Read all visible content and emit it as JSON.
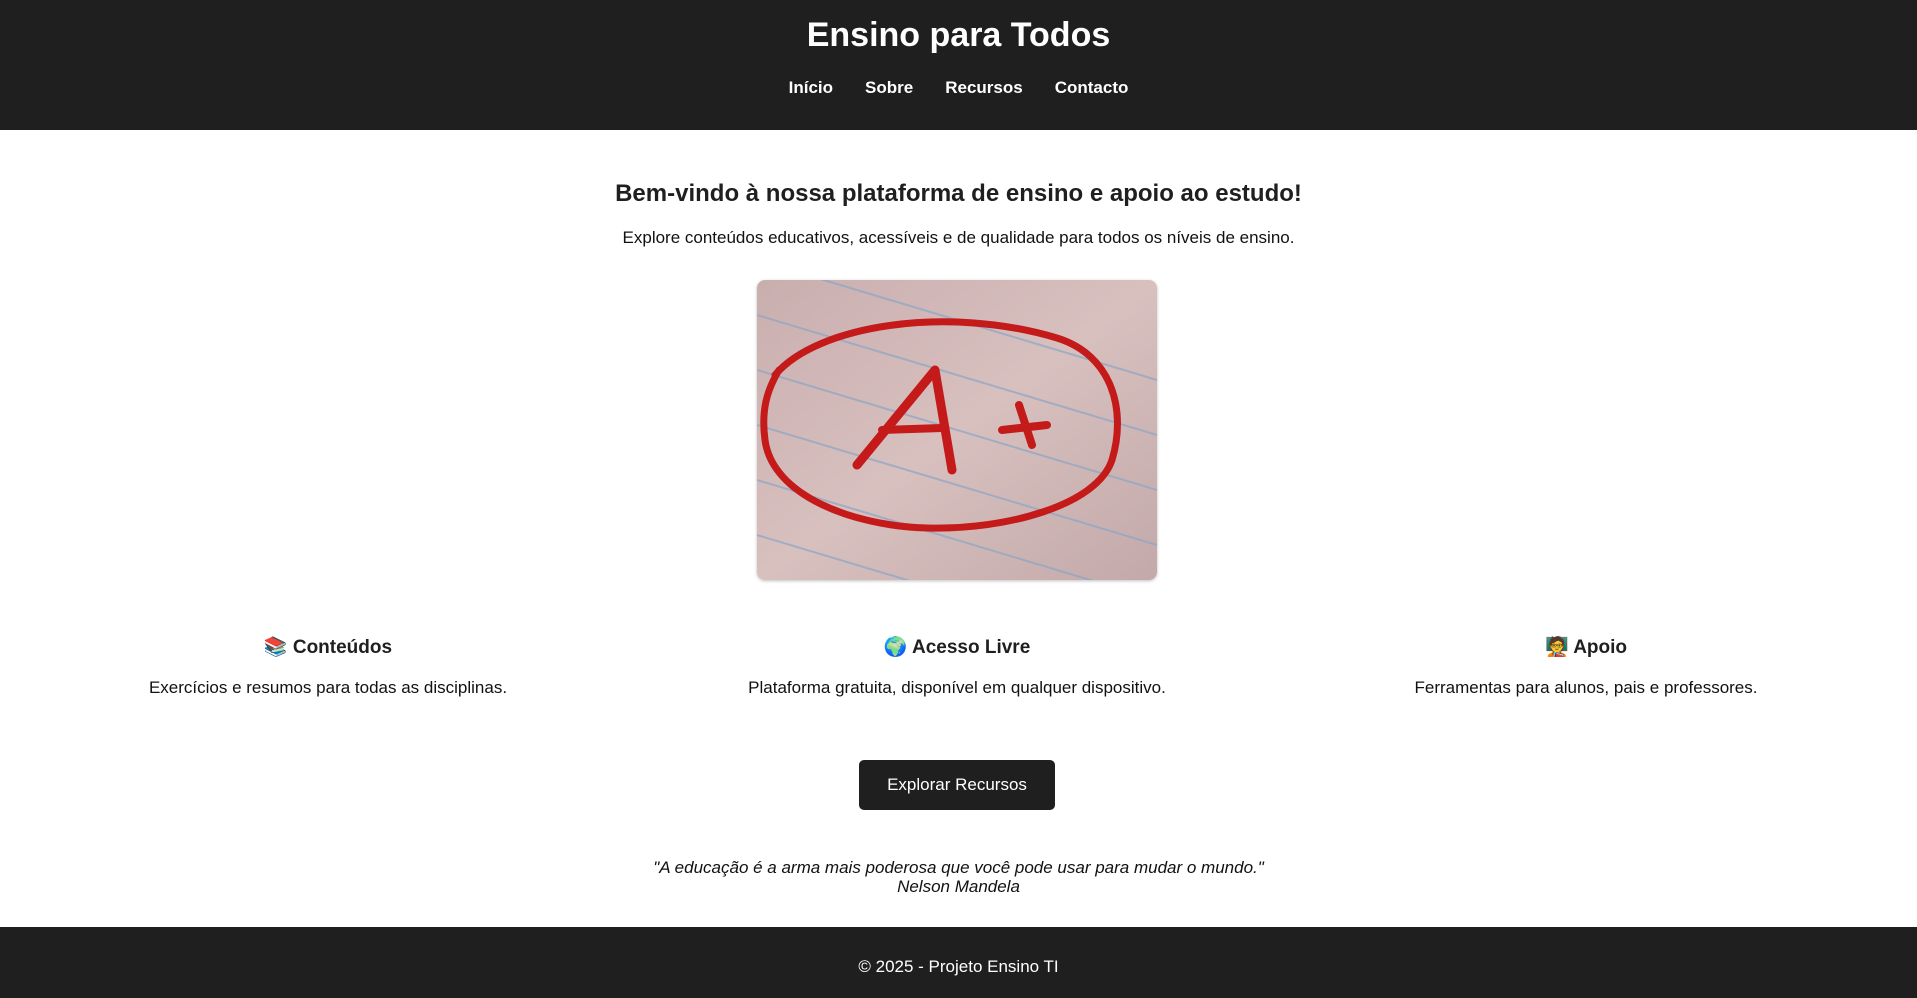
{
  "header": {
    "title": "Ensino para Todos",
    "nav": [
      "Início",
      "Sobre",
      "Recursos",
      "Contacto"
    ]
  },
  "main": {
    "welcome": "Bem-vindo à nossa plataforma de ensino e apoio ao estudo!",
    "intro": "Explore conteúdos educativos, acessíveis e de qualidade para todos os níveis de ensino.",
    "features": [
      {
        "emoji": "📚",
        "title": "Conteúdos",
        "text": "Exercícios e resumos para todas as disciplinas."
      },
      {
        "emoji": "🌍",
        "title": "Acesso Livre",
        "text": "Plataforma gratuita, disponível em qualquer dispositivo."
      },
      {
        "emoji": "🧑‍🏫",
        "title": "Apoio",
        "text": "Ferramentas para alunos, pais e professores."
      }
    ],
    "cta_label": "Explorar Recursos",
    "quote": "\"A educação é a arma mais poderosa que você pode usar para mudar o mundo.\"",
    "quote_author": "Nelson Mandela"
  },
  "footer": {
    "text": "© 2025 - Projeto Ensino TI"
  },
  "colors": {
    "dark": "#1f1f1f",
    "grade_red": "#c41a1a"
  }
}
